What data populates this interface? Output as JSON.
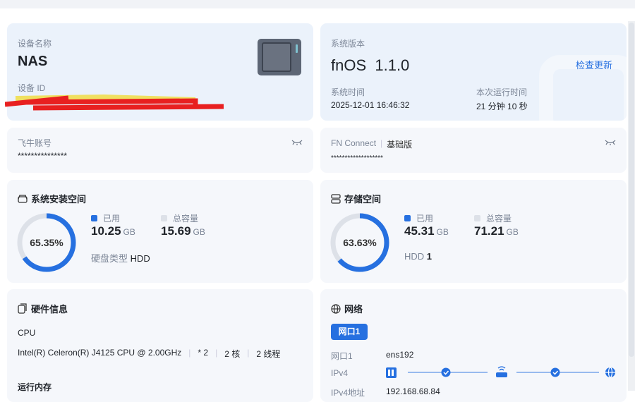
{
  "device": {
    "name_label": "设备名称",
    "name": "NAS",
    "id_label": "设备 ID"
  },
  "system": {
    "version_label": "系统版本",
    "version": "fnOS  1.1.0",
    "check_update": "检查更新",
    "time_label": "系统时间",
    "time": "2025-12-01 16:46:32",
    "uptime_label": "本次运行时间",
    "uptime": "21 分钟 10 秒"
  },
  "account": {
    "label": "飞牛账号",
    "value": "***************"
  },
  "fnconnect": {
    "label": "FN Connect",
    "edition": "基础版",
    "value": "*******************"
  },
  "sys_space": {
    "title": "系统安装空间",
    "percent": "65.35%",
    "percent_value": 65.35,
    "used_label": "已用",
    "used": "10.25",
    "used_unit": "GB",
    "total_label": "总容量",
    "total": "15.69",
    "total_unit": "GB",
    "disk_type_label": "硬盘类型",
    "disk_type": "HDD"
  },
  "storage": {
    "title": "存储空间",
    "percent": "63.63%",
    "percent_value": 63.63,
    "used_label": "已用",
    "used": "45.31",
    "used_unit": "GB",
    "total_label": "总容量",
    "total": "71.21",
    "total_unit": "GB",
    "hdd_label": "HDD",
    "hdd_count": "1"
  },
  "hardware": {
    "title": "硬件信息",
    "cpu_label": "CPU",
    "cpu_model": "Intel(R) Celeron(R) J4125 CPU @ 2.00GHz",
    "cpu_count": "* 2",
    "cores": "2 核",
    "threads": "2 线程",
    "memory_label": "运行内存"
  },
  "network": {
    "title": "网络",
    "tab": "网口1",
    "port_label": "网口1",
    "port": "ens192",
    "ipv4_label": "IPv4",
    "ipv4_addr_label": "IPv4地址",
    "ipv4_addr": "192.168.68.84"
  },
  "colors": {
    "accent": "#2670e0",
    "track": "#dde1e8"
  }
}
